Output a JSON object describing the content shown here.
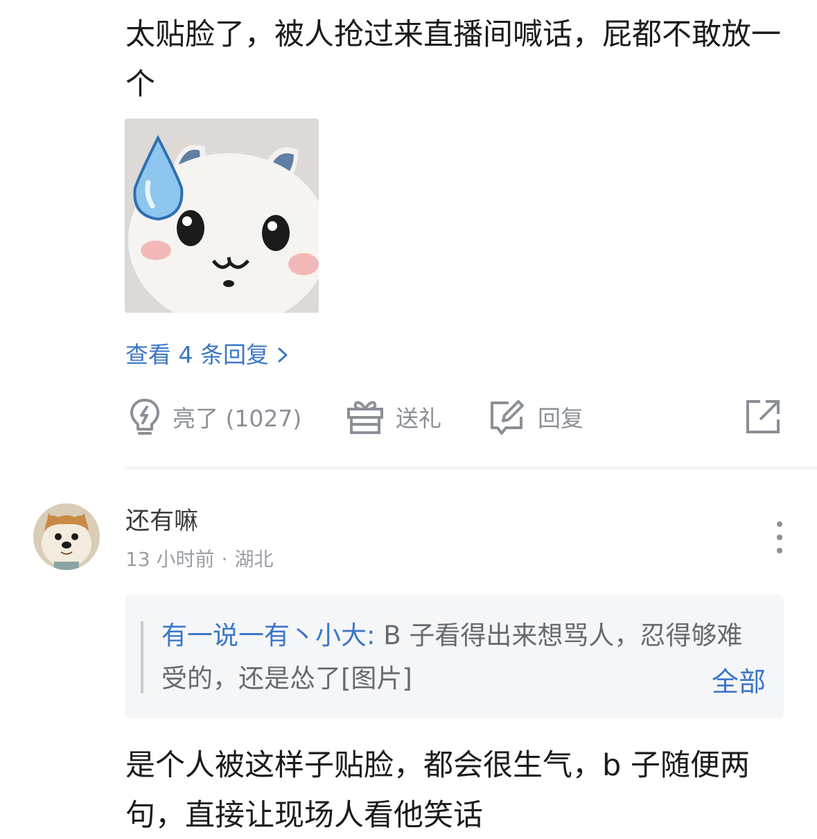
{
  "comment1": {
    "text": "太贴脸了，被人抢过来直播间喊话，屁都不敢放一个",
    "view_replies_label": "查看 4 条回复",
    "actions": {
      "like_label": "亮了 (1027)",
      "gift_label": "送礼",
      "reply_label": "回复"
    }
  },
  "comment2": {
    "username": "还有嘛",
    "time": "13 小时前",
    "separator": "·",
    "location": "湖北",
    "quote": {
      "author": "有一说一有丶小大:",
      "text": " B 子看得出来想骂人，忍得够难受的，还是怂了[图片]",
      "all_label": "全部"
    },
    "text": "是个人被这样子贴脸，都会很生气，b 子随便两句，直接让现场人看他笑话"
  },
  "colors": {
    "link": "#3b77c7",
    "icon": "#8b8f96",
    "quote_bg": "#f5f6f7"
  },
  "icons": [
    "lightbulb-icon",
    "gift-icon",
    "reply-edit-icon",
    "share-icon",
    "chevron-right-icon",
    "more-vertical-icon",
    "water-drop-icon"
  ]
}
